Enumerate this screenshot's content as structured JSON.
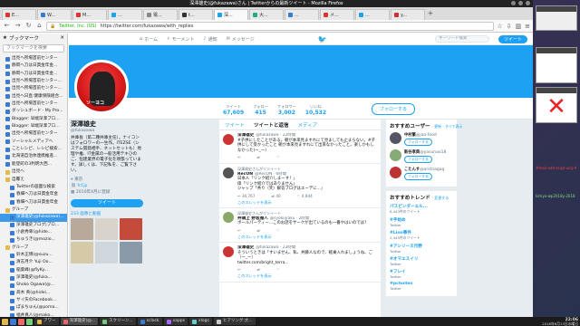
{
  "window": {
    "title": "深澤雄史(@fukazawa)さん | Twitterからの最新ツイート - Mozilla Firefox"
  },
  "tabs": [
    {
      "label": "E...",
      "color": "#d33",
      "active": false
    },
    {
      "label": "W...",
      "color": "#3b7bd4",
      "active": false
    },
    {
      "label": "M...",
      "color": "#d33",
      "active": false
    },
    {
      "label": "...",
      "color": "#1da1f2",
      "active": false
    },
    {
      "label": "電...",
      "color": "#888",
      "active": false
    },
    {
      "label": "t...",
      "color": "#333",
      "active": false
    },
    {
      "label": "深...",
      "color": "#1da1f2",
      "active": true
    },
    {
      "label": "大...",
      "color": "#2a8",
      "active": false
    },
    {
      "label": "...",
      "color": "#3b7bd4",
      "active": false
    },
    {
      "label": "メ...",
      "color": "#d33",
      "active": false
    },
    {
      "label": "...",
      "color": "#1da1f2",
      "active": false
    },
    {
      "label": "y...",
      "color": "#c33",
      "active": false
    }
  ],
  "navbar": {
    "site_label": "Twitter, Inc. (US)",
    "url": "https://twitter.com/fukazawa/with_replies"
  },
  "sidebar": {
    "title": "ブックマーク",
    "close": "✕",
    "search_placeholder": "ブックマークを検索",
    "items": [
      {
        "label": "出見ヘ所場首前センター",
        "level": 0,
        "type": "link"
      },
      {
        "label": "静岡へ刀は日貫金年金...",
        "level": 0,
        "type": "link"
      },
      {
        "label": "静岡へ刀は日貫金年金...",
        "level": 0,
        "type": "link"
      },
      {
        "label": "出見ヘ所場首前センター...",
        "level": 0,
        "type": "link"
      },
      {
        "label": "出見ヘ所場首前センター...",
        "level": 0,
        "type": "link"
      },
      {
        "label": "出見ヘ日直:健康保険組合...",
        "level": 0,
        "type": "link"
      },
      {
        "label": "出見ヘ所場首前センター",
        "level": 0,
        "type": "link"
      },
      {
        "label": "ダッシュボード - My Pro...",
        "level": 0,
        "type": "link"
      },
      {
        "label": "Blogger: 早端深澤ブロ...",
        "level": 0,
        "type": "link"
      },
      {
        "label": "Blogger: 早端深澤ブロ...",
        "level": 0,
        "type": "link"
      },
      {
        "label": "出見ヘ所場首前センター",
        "level": 0,
        "type": "link"
      },
      {
        "label": "ソーシャルメディアへ",
        "level": 0,
        "type": "link"
      },
      {
        "label": "ことレシピ、レシピ検索...",
        "level": 0,
        "type": "link"
      },
      {
        "label": "北海道自治体連携推進...",
        "level": 0,
        "type": "link"
      },
      {
        "label": "能登町の3判明大西...",
        "level": 0,
        "type": "link"
      },
      {
        "label": "出見へ",
        "level": 0,
        "type": "folder"
      },
      {
        "label": "自覆え",
        "level": 0,
        "type": "folder"
      },
      {
        "label": "Twitterの画面な検索",
        "level": 1,
        "type": "link"
      },
      {
        "label": "春細ヘ刀は日貫金年金",
        "level": 1,
        "type": "link"
      },
      {
        "label": "春細ヘ刀は日貫金年金",
        "level": 1,
        "type": "link"
      },
      {
        "label": "グループ",
        "level": 0,
        "type": "folder"
      },
      {
        "label": "深澤雄史(@fukazawa)...",
        "level": 1,
        "type": "link",
        "selected": true
      },
      {
        "label": "深澤雄史ブログ|ブロ...",
        "level": 1,
        "type": "link"
      },
      {
        "label": "小倉秀幸(@hide...",
        "level": 1,
        "type": "link"
      },
      {
        "label": "ちゅうき(@mozio...",
        "level": 1,
        "type": "link"
      },
      {
        "label": "グループ",
        "level": 0,
        "type": "folder"
      },
      {
        "label": "鈴木正博(@suzu...",
        "level": 1,
        "type": "link"
      },
      {
        "label": "清志月介 Yuji Oo...",
        "level": 1,
        "type": "link"
      },
      {
        "label": "稲葉峰(@flyKy...",
        "level": 1,
        "type": "link"
      },
      {
        "label": "深澤雄史(@fuka...",
        "level": 1,
        "type": "link"
      },
      {
        "label": "Shoko Ogawa(@...",
        "level": 1,
        "type": "link"
      },
      {
        "label": "髙木 英(@hidei...",
        "level": 1,
        "type": "link"
      },
      {
        "label": "サイ矢のFacebook...",
        "level": 1,
        "type": "link"
      },
      {
        "label": "ぽまちゅん(@poma...",
        "level": 1,
        "type": "link"
      },
      {
        "label": "福井真人(@mako...",
        "level": 1,
        "type": "link"
      },
      {
        "label": "Twitter / Tw...",
        "level": 1,
        "type": "link"
      }
    ]
  },
  "twitter": {
    "nav": [
      {
        "icon": "home-icon",
        "label": "ホーム"
      },
      {
        "icon": "moments-icon",
        "label": "モーメント"
      },
      {
        "icon": "bell-icon",
        "label": "通知"
      },
      {
        "icon": "mail-icon",
        "label": "メッセージ"
      }
    ],
    "search_placeholder": "キーワード検索",
    "tweet_button": "ツイート",
    "stats": [
      {
        "label": "ツイート",
        "value": "67,609"
      },
      {
        "label": "フォロー",
        "value": "415"
      },
      {
        "label": "フォロワー",
        "value": "3,002"
      },
      {
        "label": "いいね",
        "value": "10,532"
      }
    ],
    "follow_button": "フォローする",
    "avatar_tag": "ソーヨコ",
    "profile": {
      "name": "深澤雄史",
      "handle": "@fukazawa",
      "bio": "井庫長（第二種井庫主任）。ナイコンはフォロワーの一生作。ITEZSE（システム開発相手、ネットセットも）地理や推、IT金属の一般活用テキひのご、恒建業界の電子化を頑張っています。詳しくは、下記私を、ご覧下さい。",
      "location": "東京",
      "link": "fcf.jp",
      "joined": "2010年4月に登録",
      "tweet_btn": "ツイート",
      "media_label": "233 画像と動画"
    },
    "timeline_tabs": [
      {
        "label": "ツイート",
        "active": false
      },
      {
        "label": "ツイートと返信",
        "active": true
      },
      {
        "label": "メディア",
        "active": false
      }
    ],
    "tweets": [
      {
        "context": "",
        "name": "深澤雄史",
        "handle": "@fukazawa · 22時間",
        "body": "#子供にしたことがある。朝が本来見ますれにて見ましても止まらない。#子供にして受かったこと 朝が本来見ますれにて出来なかったこと。楽しかもしなかった(ー_ー)",
        "link": "",
        "likes": "",
        "retweets": "",
        "replies": "",
        "thread": ""
      },
      {
        "context": "深澤雄史さんがリツイート",
        "name": "RecON",
        "handle": "@RecON · 6時間",
        "body": "日本人「リンク紹介しまーす！」\n偉「リンク紹介ではありません」\nジャップ「共り（笑）解答ブログはエーデに...」",
        "link": "",
        "likes": "4,944",
        "retweets": "40",
        "replies": "30,767",
        "thread": "このスレッドを表示"
      },
      {
        "context": "深澤雄史さんがリツイート",
        "name": "井頭上 野坂雅人",
        "handle": "@syokuyaku · 2時間",
        "body": "ボールパーティー...このお話をサークが出ているのも一番やはいのでは？",
        "link": "",
        "likes": "",
        "retweets": "",
        "replies": "",
        "thread": "このスレッドを表示"
      },
      {
        "context": "",
        "name": "深澤雄史",
        "handle": "@fukazawa · 23時間",
        "body": "そういうときは「すいません、私、井藤人なので、軽乗入れましょうね、ご（ー_ー）",
        "link": "twitter.com/bright_terra...",
        "likes": "",
        "retweets": "",
        "replies": "",
        "thread": "このスレッドを表示"
      }
    ],
    "suggest_title": "おすすめユーザー",
    "suggest_links": "· 更新 · すべて表示",
    "suggestions": [
      {
        "name": "中村繁",
        "handle": "@jaa-food",
        "btn": "フォローする",
        "color": "#556"
      },
      {
        "name": "新谷孝典",
        "handle": "@yasunao18",
        "btn": "フォローする",
        "color": "#8a7"
      },
      {
        "name": "こたんす",
        "handle": "@arstnagaq",
        "btn": "フォローする",
        "color": "#b33"
      }
    ],
    "trends_title": "おすすめトレンド",
    "trends_change": "· 変更する",
    "trends": [
      {
        "name": "パスピンダーエル...",
        "count": "8,443件のツイート"
      },
      {
        "name": "#手始め",
        "count": "Twitter"
      },
      {
        "name": "#Lion事件",
        "count": "2,445件のツイート"
      },
      {
        "name": "#アシリーヌ月野",
        "count": "Twitter"
      },
      {
        "name": "#オマエスイリ",
        "count": "Twitter"
      },
      {
        "name": "#フレイ",
        "count": "Twitter"
      },
      {
        "name": "#pcholles",
        "count": "Twitter"
      }
    ]
  },
  "desktop_widgets": {
    "text_red": "#mail-add-ecqd-ucq-#",
    "text_green": "kimyo-wp2018y-2018"
  },
  "taskbar": {
    "items": [
      {
        "label": "アワー",
        "active": false
      },
      {
        "label": "深澤雄史(@...",
        "active": true
      },
      {
        "label": "スクリーン...",
        "active": false
      },
      {
        "label": "sclock",
        "active": false
      },
      {
        "label": "xapps",
        "active": false
      },
      {
        "label": "xlogs",
        "active": false
      },
      {
        "label": "ヒアリング:大...",
        "active": false
      }
    ],
    "time": "22:06",
    "date": "2018年6月13日水曜日"
  }
}
